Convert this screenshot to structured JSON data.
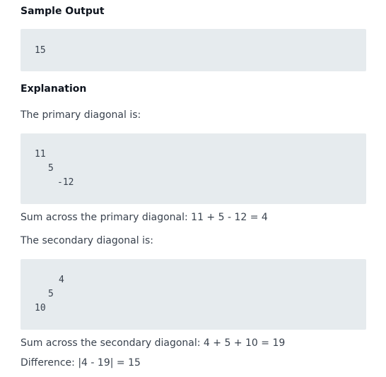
{
  "sample_output": {
    "heading": "Sample Output",
    "code_lines": [
      "15"
    ]
  },
  "explanation": {
    "heading": "Explanation",
    "primary_intro": "The primary diagonal is:",
    "primary_code_lines": [
      "11",
      "5",
      "-12"
    ],
    "primary_sum": "Sum across the primary diagonal: 11 + 5 - 12 = 4",
    "secondary_intro": "The secondary diagonal is:",
    "secondary_code_lines": [
      "4",
      "5",
      "10"
    ],
    "secondary_sum": "Sum across the secondary diagonal: 4 + 5 + 10 = 19",
    "difference": "Difference: |4 - 19| = 15"
  }
}
